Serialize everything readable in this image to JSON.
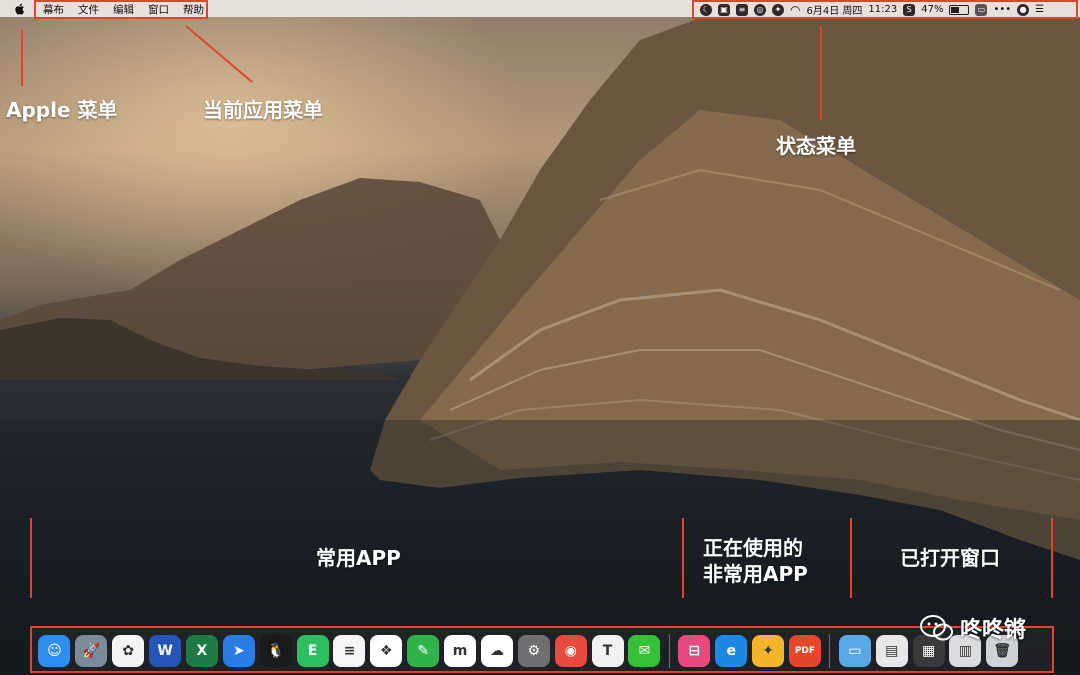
{
  "menubar": {
    "menus": [
      "幕布",
      "文件",
      "编辑",
      "窗口",
      "帮助"
    ],
    "status": {
      "date": "6月4日 周四",
      "time": "11:23",
      "battery": "47%"
    }
  },
  "annotations": {
    "apple_menu": "Apple  菜单",
    "app_menu": "当前应用菜单",
    "status_menu": "状态菜单",
    "common_apps": "常用APP",
    "in_use_line1": "正在使用的",
    "in_use_line2": "非常用APP",
    "open_windows": "已打开窗口"
  },
  "dock": {
    "apps": [
      {
        "name": "finder-icon",
        "color": "#2b8ef0",
        "glyph": "☺",
        "running": true
      },
      {
        "name": "launchpad-icon",
        "color": "#7d8a9a",
        "glyph": "🚀",
        "running": false
      },
      {
        "name": "photos-icon",
        "color": "#f4f4f4",
        "glyph": "✿",
        "running": false
      },
      {
        "name": "word-icon",
        "color": "#2456b8",
        "glyph": "W",
        "running": false
      },
      {
        "name": "excel-icon",
        "color": "#1e7b45",
        "glyph": "X",
        "running": false
      },
      {
        "name": "safari-compass-icon",
        "color": "#2a7be4",
        "glyph": "➤",
        "running": false
      },
      {
        "name": "qq-penguin-icon",
        "color": "#1a1a1a",
        "glyph": "🐧",
        "running": true
      },
      {
        "name": "evernote-icon",
        "color": "#2dbe60",
        "glyph": "E",
        "running": false
      },
      {
        "name": "reminders-icon",
        "color": "#f5f5f5",
        "glyph": "≡",
        "running": false
      },
      {
        "name": "mubu-icon",
        "color": "#ffffff",
        "glyph": "❖",
        "running": true
      },
      {
        "name": "notes-green-icon",
        "color": "#2fb24c",
        "glyph": "✎",
        "running": false
      },
      {
        "name": "m-app-icon",
        "color": "#ffffff",
        "glyph": "m",
        "running": false
      },
      {
        "name": "baidu-netdisk-icon",
        "color": "#ffffff",
        "glyph": "☁",
        "running": true
      },
      {
        "name": "system-preferences-icon",
        "color": "#6f6f6f",
        "glyph": "⚙",
        "running": false
      },
      {
        "name": "chrome-icon",
        "color": "#e9493f",
        "glyph": "◉",
        "running": true
      },
      {
        "name": "typora-icon",
        "color": "#f2f2f2",
        "glyph": "T",
        "running": false
      },
      {
        "name": "wechat-icon",
        "color": "#36c03a",
        "glyph": "✉",
        "running": true
      }
    ],
    "in_use_apps": [
      {
        "name": "pink-app-icon",
        "color": "#e84a7e",
        "glyph": "⊟",
        "running": true
      },
      {
        "name": "edge-icon",
        "color": "#1e88e5",
        "glyph": "e",
        "running": true
      },
      {
        "name": "yellow-app-icon",
        "color": "#f5b52a",
        "glyph": "✦",
        "running": true
      },
      {
        "name": "pdf-expert-icon",
        "color": "#e5472d",
        "glyph": "PDF",
        "running": true
      }
    ],
    "windows": [
      {
        "name": "folder-icon",
        "color": "#5aa7e6",
        "glyph": "▭",
        "running": false
      },
      {
        "name": "window-thumb-icon",
        "color": "#e7e7e7",
        "glyph": "▤",
        "running": false
      },
      {
        "name": "window-thumb-icon",
        "color": "#3a3a3a",
        "glyph": "▦",
        "running": false
      },
      {
        "name": "window-thumb-icon",
        "color": "#dcdcdc",
        "glyph": "▥",
        "running": false
      },
      {
        "name": "trash-icon",
        "color": "#cfd3d8",
        "glyph": "🗑",
        "running": false
      }
    ]
  },
  "watermark": "咚咚锵"
}
